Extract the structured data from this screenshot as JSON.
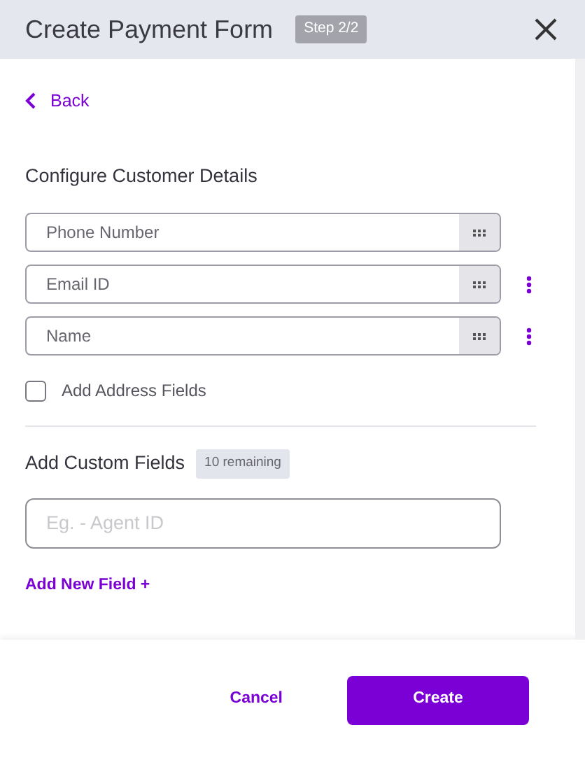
{
  "header": {
    "title": "Create Payment Form",
    "step": "Step 2/2"
  },
  "back": {
    "label": "Back"
  },
  "customer_details": {
    "title": "Configure Customer Details",
    "fields": [
      {
        "value": "Phone Number",
        "has_menu": false
      },
      {
        "value": "Email ID",
        "has_menu": true
      },
      {
        "value": "Name",
        "has_menu": true
      }
    ],
    "address_checkbox": {
      "label": "Add Address Fields",
      "checked": false
    }
  },
  "custom_fields": {
    "title": "Add Custom Fields",
    "remaining": "10 remaining",
    "placeholder": "Eg. - Agent ID",
    "add_link": "Add New Field +"
  },
  "footer": {
    "cancel": "Cancel",
    "create": "Create"
  }
}
